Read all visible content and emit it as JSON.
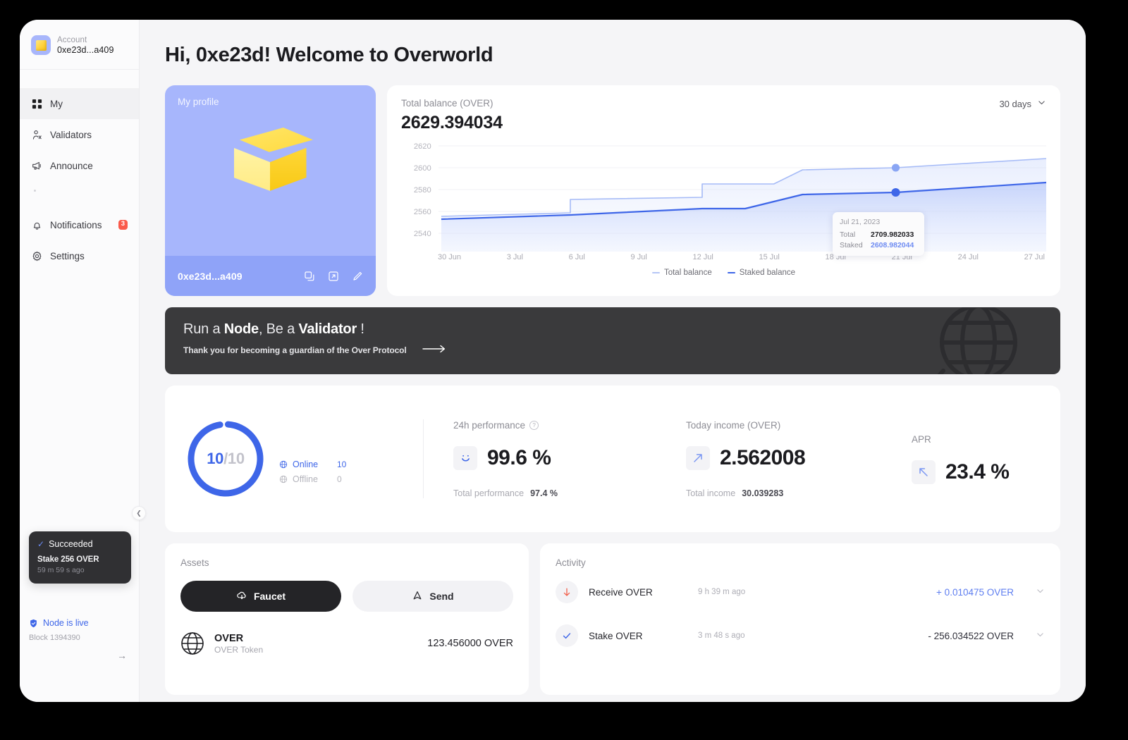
{
  "sidebar": {
    "account": {
      "label": "Account",
      "address": "0xe23d...a409",
      "avatar_icon": "cube-icon"
    },
    "items": [
      {
        "label": "My",
        "icon": "grid-icon",
        "active": true
      },
      {
        "label": "Validators",
        "icon": "person-icon",
        "active": false
      },
      {
        "label": "Announce",
        "icon": "megaphone-icon",
        "active": false
      },
      {
        "label": "Notifications",
        "icon": "bell-icon",
        "badge": "3",
        "active": false
      },
      {
        "label": "Settings",
        "icon": "gear-icon",
        "active": false
      }
    ],
    "collapse_icon": "chevron-left-icon",
    "toast": {
      "status": "Succeeded",
      "status_icon": "check-icon",
      "detail": "Stake 256 OVER",
      "time": "59 m 59 s ago"
    },
    "node": {
      "status": "Node is live",
      "status_icon": "shield-check-icon",
      "block": "Block 1394390",
      "arrow_icon": "arrow-right-icon"
    }
  },
  "header": {
    "title": "Hi, 0xe23d! Welcome to Overworld"
  },
  "profile": {
    "label": "My profile",
    "address": "0xe23d...a409",
    "actions": [
      {
        "name": "copy-icon"
      },
      {
        "name": "external-link-icon"
      },
      {
        "name": "edit-icon"
      }
    ]
  },
  "balance": {
    "title": "Total balance (OVER)",
    "value": "2629.394034",
    "range": "30 days",
    "range_icon": "chevron-down-icon",
    "tooltip": {
      "date": "Jul 21, 2023",
      "total_label": "Total",
      "total_value": "2709.982033",
      "staked_label": "Staked",
      "staked_value": "2608.982044"
    }
  },
  "chart_data": {
    "type": "line",
    "title": "Total balance (OVER)",
    "xlabel": "",
    "ylabel": "",
    "ylim": [
      2530,
      2628
    ],
    "yticks": [
      2620,
      2600,
      2580,
      2560,
      2540
    ],
    "x": [
      "30 Jun",
      "3 Jul",
      "6 Jul",
      "9 Jul",
      "12 Jul",
      "15 Jul",
      "18 Jul",
      "21 Jul",
      "24 Jul",
      "27 Jul"
    ],
    "grid": true,
    "legend_position": "bottom",
    "series": [
      {
        "name": "Total balance",
        "color": "#9cb2f5",
        "step": true,
        "values": [
          2559,
          2561,
          2572,
          2574,
          2576,
          2588,
          2592,
          2598,
          2604,
          2612
        ]
      },
      {
        "name": "Staked balance",
        "color": "#3e66e8",
        "step": false,
        "values": [
          2556,
          2558,
          2561,
          2564,
          2567,
          2572,
          2578,
          2581,
          2586,
          2592
        ]
      }
    ],
    "annotation": {
      "x": "21 Jul",
      "date": "Jul 21, 2023",
      "total": 2709.982033,
      "staked": 2608.982044
    }
  },
  "banner": {
    "title_pre": "Run a ",
    "title_b1": "Node",
    "title_mid": ", Be a ",
    "title_b2": "Validator",
    "title_post": " !",
    "subtitle": "Thank you for becoming a guardian of the Over Protocol",
    "arrow_icon": "arrow-right-icon",
    "decoration_icon": "globe-icon"
  },
  "stats": {
    "donut": {
      "value": "10",
      "separator": "/",
      "total": "10",
      "legend": [
        {
          "label": "Online",
          "value": "10",
          "icon": "globe-icon"
        },
        {
          "label": "Offline",
          "value": "0",
          "icon": "globe-icon"
        }
      ]
    },
    "performance": {
      "title": "24h performance",
      "help_icon": "question-icon",
      "icon": "smiley-icon",
      "value": "99.6 %",
      "foot_label": "Total performance",
      "foot_value": "97.4 %"
    },
    "income": {
      "title": "Today income (OVER)",
      "icon": "arrow-up-right-icon",
      "value": "2.562008",
      "foot_label": "Total income",
      "foot_value": "30.039283"
    },
    "apr": {
      "title": "APR",
      "icon": "arrow-up-left-icon",
      "value": "23.4 %"
    }
  },
  "assets": {
    "title": "Assets",
    "faucet_label": "Faucet",
    "faucet_icon": "cloud-download-icon",
    "send_label": "Send",
    "send_icon": "send-icon",
    "token": {
      "icon": "globe-icon",
      "name": "OVER",
      "sub": "OVER Token",
      "amount": "123.456000 OVER"
    }
  },
  "activity": {
    "title": "Activity",
    "rows": [
      {
        "icon": "arrow-down-icon",
        "name": "Receive OVER",
        "time": "9 h 39 m ago",
        "amount": "+ 0.010475 OVER",
        "sign": "pos",
        "chevron": "chevron-down-icon"
      },
      {
        "icon": "check-icon",
        "name": "Stake OVER",
        "time": "3 m 48 s ago",
        "amount": "- 256.034522 OVER",
        "sign": "neg",
        "chevron": "chevron-down-icon"
      }
    ]
  }
}
